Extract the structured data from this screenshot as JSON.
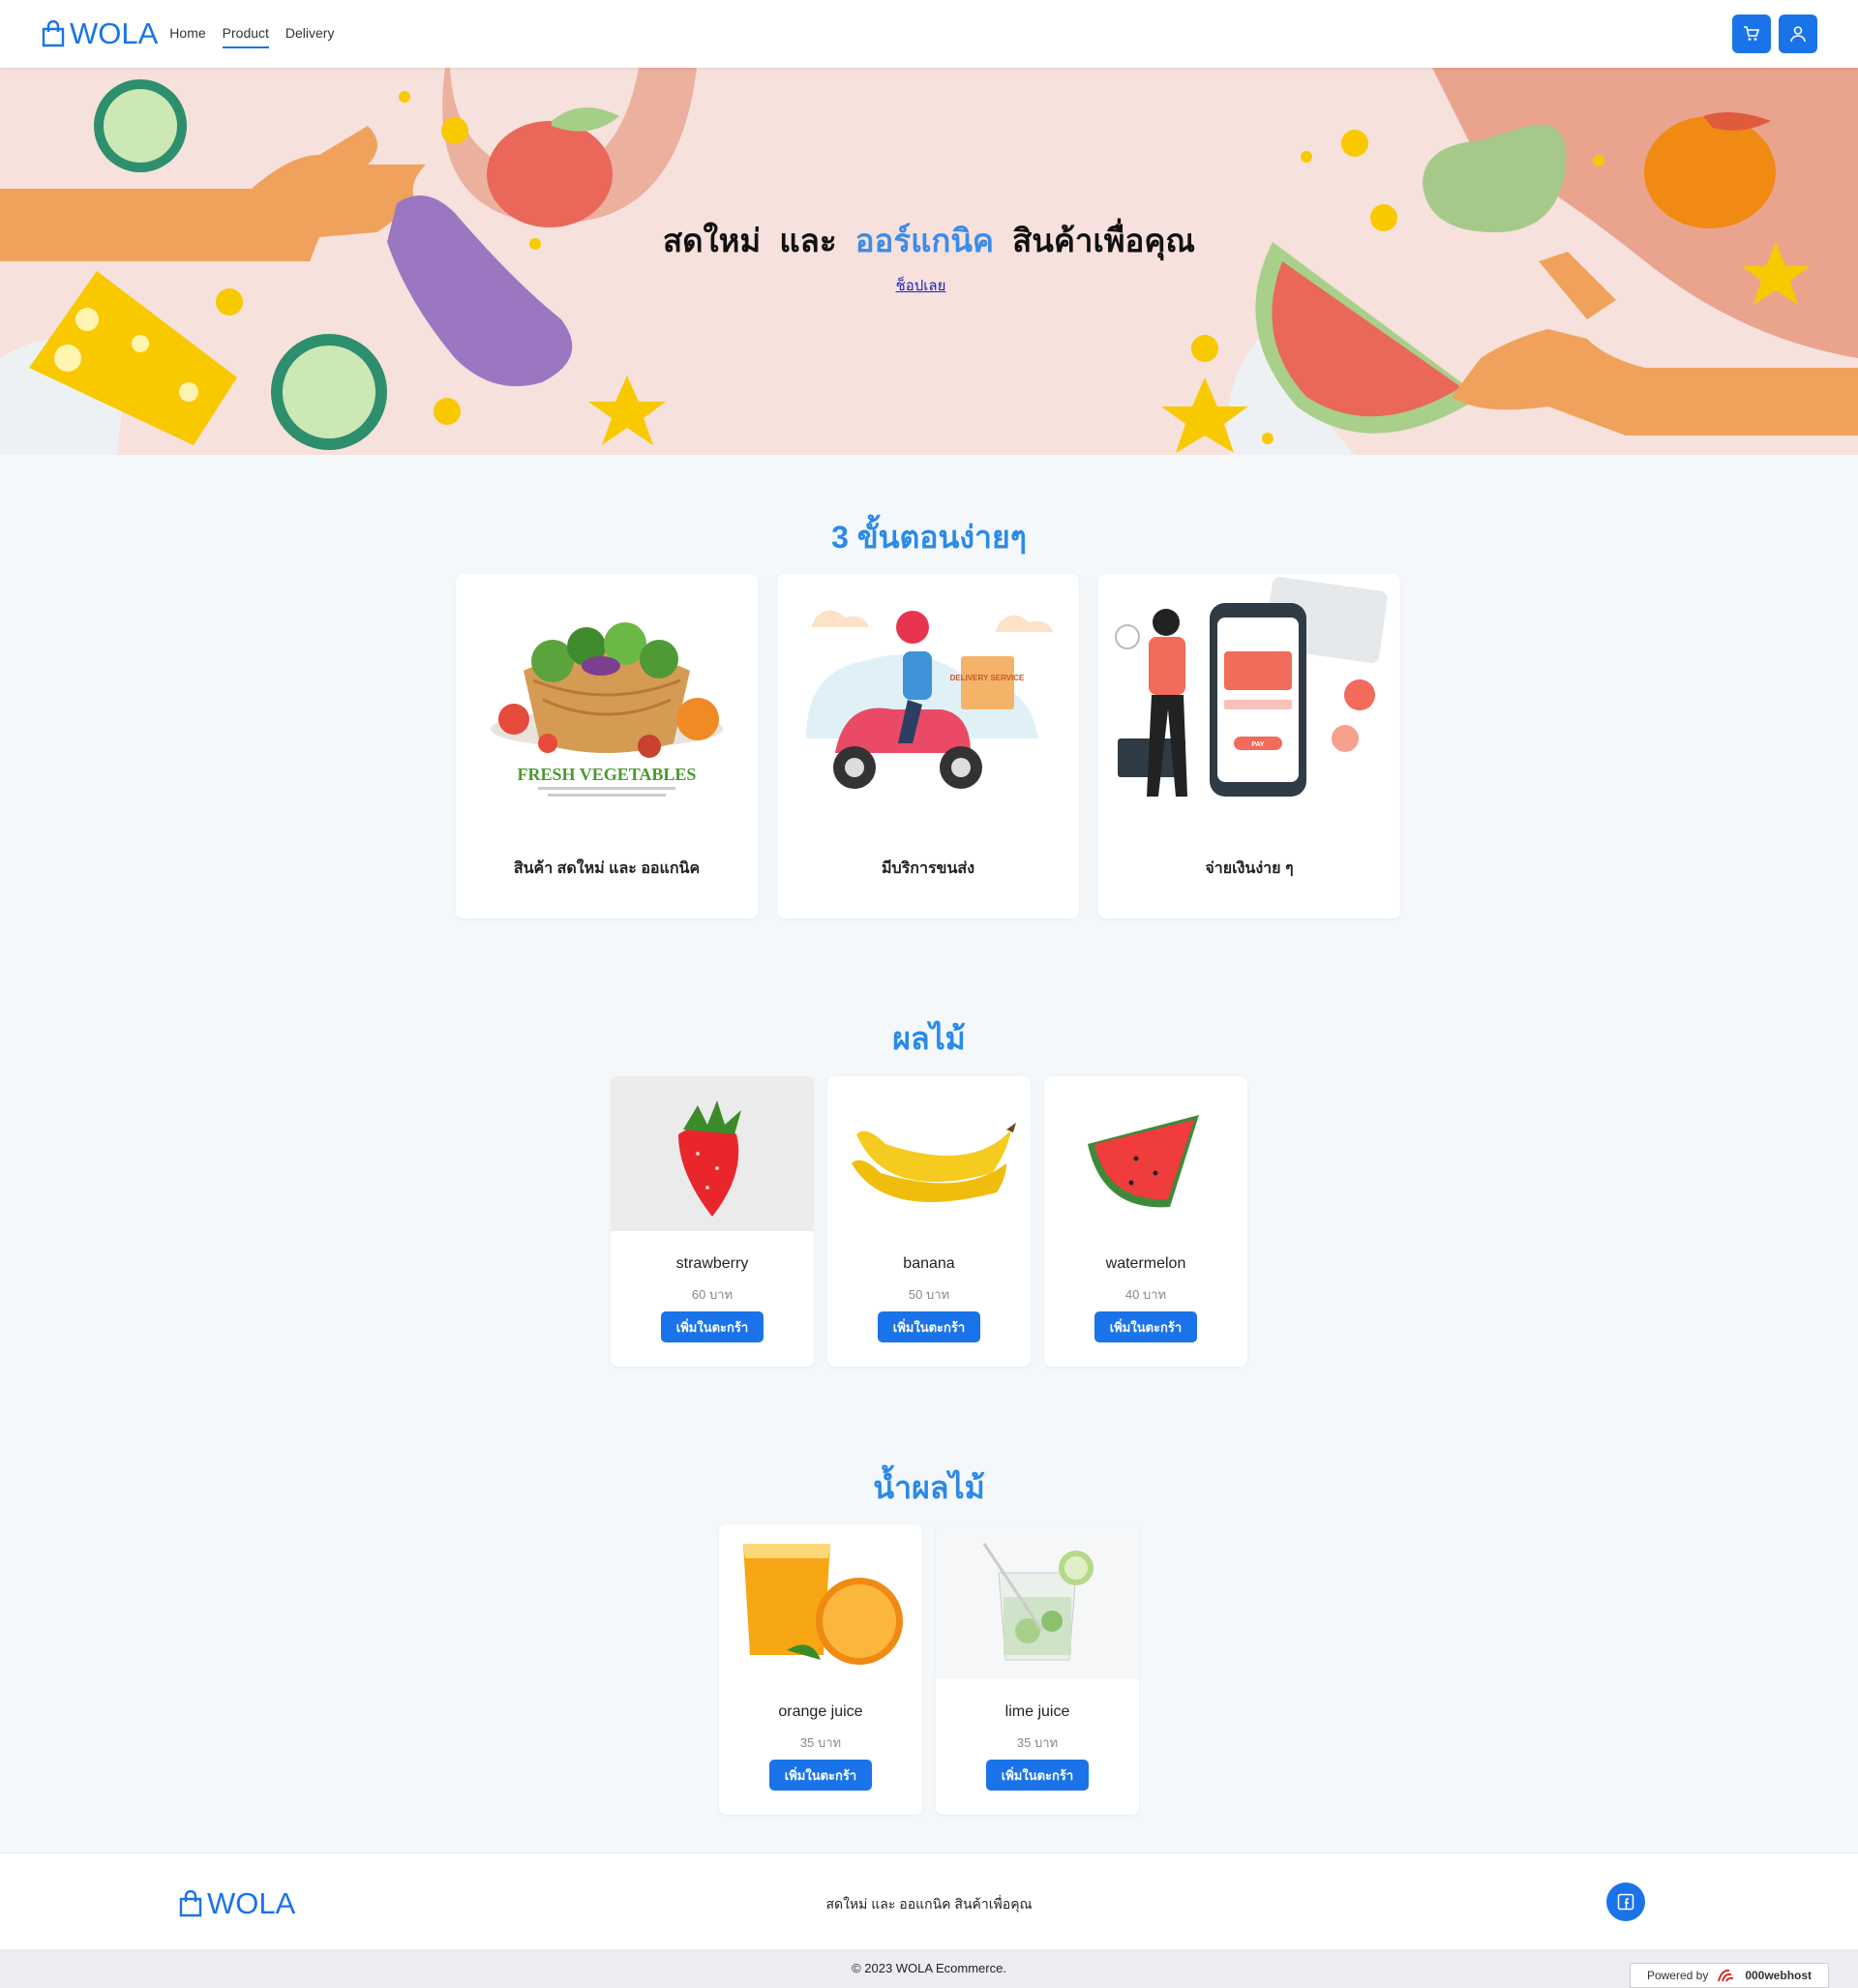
{
  "nav": {
    "brand": "WOLA",
    "links": [
      "Home",
      "Product",
      "Delivery"
    ],
    "active_link": "Product",
    "cart_icon": "cart-icon",
    "user_icon": "user-icon"
  },
  "hero": {
    "title_part1": "สดใหม่",
    "title_and": "และ",
    "title_accent": "ออร์แกนิค",
    "title_part2": "สินค้าเพื่อคุณ",
    "cta": "ช็อปเลย",
    "vegetable_basket_caption": "FRESH VEGETABLES",
    "delivery_box_text": "DELIVERY SERVICE",
    "pay_button_text": "PAY"
  },
  "steps": {
    "title": "3 ขั้นตอนง่ายๆ",
    "items": [
      {
        "label": "สินค้า สดใหม่ และ ออแกนิค"
      },
      {
        "label": "มีบริการขนส่ง"
      },
      {
        "label": "จ่ายเงินง่าย ๆ"
      }
    ]
  },
  "fruits": {
    "title": "ผลไม้",
    "items": [
      {
        "name": "strawberry",
        "price": "60 บาท",
        "button": "เพิ่มในตะกร้า"
      },
      {
        "name": "banana",
        "price": "50 บาท",
        "button": "เพิ่มในตะกร้า"
      },
      {
        "name": "watermelon",
        "price": "40 บาท",
        "button": "เพิ่มในตะกร้า"
      }
    ]
  },
  "juices": {
    "title": "น้ำผลไม้",
    "items": [
      {
        "name": "orange juice",
        "price": "35 บาท",
        "button": "เพิ่มในตะกร้า"
      },
      {
        "name": "lime juice",
        "price": "35 บาท",
        "button": "เพิ่มในตะกร้า"
      }
    ]
  },
  "footer": {
    "brand": "WOLA",
    "tagline": "สดใหม่ และ ออแกนิค สินค้าเพื่อคุณ",
    "social_icon": "facebook-icon",
    "copyright": "© 2023 WOLA Ecommerce.",
    "powered_by": "Powered by",
    "host": "000webhost"
  },
  "colors": {
    "primary": "#1a73e8",
    "heading": "#2a8ae8",
    "hero_bg": "#f6e1dc",
    "page_bg": "#f4f8fb"
  }
}
